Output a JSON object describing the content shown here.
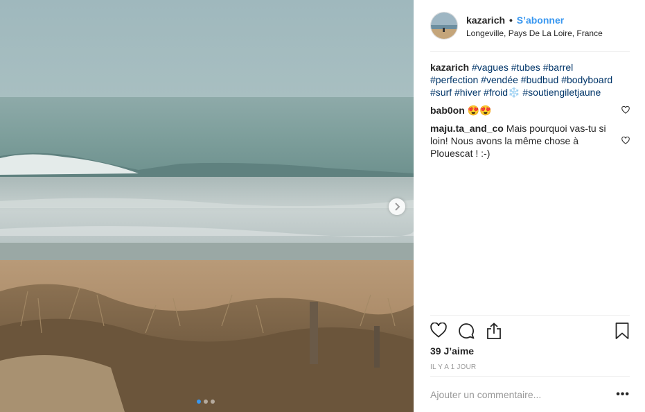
{
  "post": {
    "username": "kazarich",
    "separator": "•",
    "follow_label": "S’abonner",
    "location": "Longeville, Pays De La Loire, France"
  },
  "caption": {
    "author": "kazarich",
    "tags": [
      "#vagues",
      "#tubes",
      "#barrel",
      "#perfection",
      "#vendée",
      "#budbud",
      "#bodyboard",
      "#surf",
      "#hiver",
      "#froid❄️",
      "#soutiengiletjaune"
    ]
  },
  "comments": [
    {
      "author": "bab0on",
      "text": "😍😍"
    },
    {
      "author": "maju.ta_and_co",
      "text": "Mais pourquoi vas-tu si loin! Nous avons la même chose à Plouescat ! :-)"
    }
  ],
  "likes_text": "39 J’aime",
  "timestamp": "IL Y A 1 JOUR",
  "add_comment_placeholder": "Ajouter un commentaire...",
  "more_label": "•••",
  "carousel": {
    "total": 3,
    "current": 1
  },
  "icons": {
    "like": "heart-icon",
    "comment": "comment-bubble-icon",
    "share": "share-icon",
    "save": "bookmark-icon",
    "next": "chevron-right-icon"
  },
  "colors": {
    "link": "#3897f0",
    "hashtag": "#003569",
    "text": "#262626",
    "muted": "#999999"
  }
}
